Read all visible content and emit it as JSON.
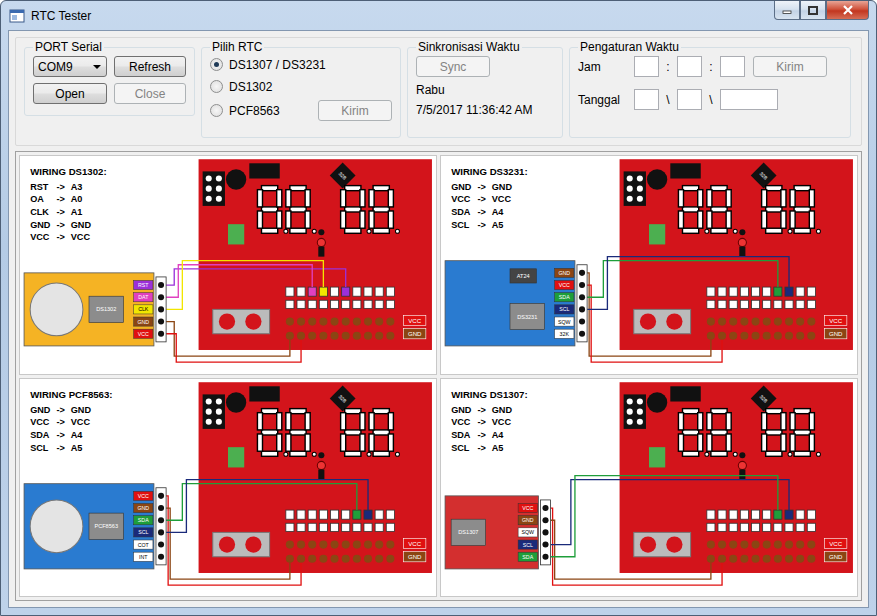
{
  "window": {
    "title": "RTC Tester"
  },
  "serial_port": {
    "title": "PORT Serial",
    "port": "COM9",
    "buttons": [
      {
        "label": "Refresh",
        "disabled": false
      },
      {
        "label": "Open",
        "disabled": false
      },
      {
        "label": "Close",
        "disabled": true
      }
    ]
  },
  "rtc_select": {
    "title": "Pilih RTC",
    "options": [
      {
        "label": "DS1307 / DS3231",
        "selected": true
      },
      {
        "label": "DS1302",
        "selected": false
      },
      {
        "label": "PCF8563",
        "selected": false
      }
    ],
    "send_button": {
      "label": "Kirim",
      "disabled": true
    }
  },
  "sync": {
    "title": "Sinkronisasi Waktu",
    "button": {
      "label": "Sync",
      "disabled": true
    },
    "day": "Rabu",
    "datetime": "7/5/2017 11:36:42 AM"
  },
  "time_setting": {
    "title": "Pengaturan Waktu",
    "time_label": "Jam",
    "time_separator": ":",
    "time_fields": [
      {
        "value": ""
      },
      {
        "value": ""
      },
      {
        "value": ""
      }
    ],
    "send_button": {
      "label": "Kirim",
      "disabled": true
    },
    "date_label": "Tanggal",
    "date_separator": "\\",
    "date_fields": [
      {
        "value": ""
      },
      {
        "value": ""
      },
      {
        "value": ""
      }
    ]
  },
  "diagrams": [
    {
      "title": "WIRING DS1302:",
      "arrow": "->",
      "wiring": [
        {
          "from": "RST",
          "to": "A3"
        },
        {
          "from": "OA",
          "to": "A0"
        },
        {
          "from": "CLK",
          "to": "A1"
        },
        {
          "from": "GND",
          "to": "GND"
        },
        {
          "from": "VCC",
          "to": "VCC"
        }
      ],
      "module": {
        "kind": "battery",
        "color": "#f5b324",
        "chips": [
          "DS1302"
        ],
        "pins": [
          {
            "label": "RST",
            "color": "#9b30d9",
            "to": "A3"
          },
          {
            "label": "DAT",
            "color": "#e040c0",
            "to": "A0"
          },
          {
            "label": "CLK",
            "color": "#f2e600",
            "to": "A1"
          },
          {
            "label": "GND",
            "color": "#8b4513",
            "to": "GND"
          },
          {
            "label": "VCC",
            "color": "#e01010",
            "to": "VCC"
          }
        ]
      },
      "board": {
        "chip": "328",
        "labels": [
          "VCC",
          "GND"
        ]
      }
    },
    {
      "title": "WIRING DS3231:",
      "arrow": "->",
      "wiring": [
        {
          "from": "GND",
          "to": "GND"
        },
        {
          "from": "VCC",
          "to": "VCC"
        },
        {
          "from": "SDA",
          "to": "A4"
        },
        {
          "from": "SCL",
          "to": "A5"
        }
      ],
      "module": {
        "kind": "battery-less",
        "color": "#2a7bd0",
        "chips": [
          "AT24",
          "DS3231"
        ],
        "pins": [
          {
            "label": "GND",
            "color": "#8b4513",
            "to": "GND"
          },
          {
            "label": "VCC",
            "color": "#e01010",
            "to": "VCC"
          },
          {
            "label": "SDA",
            "color": "#1e9e3a",
            "to": "A4"
          },
          {
            "label": "SCL",
            "color": "#1a2a7a",
            "to": "A5"
          },
          {
            "label": "SQW",
            "color": "#ffffff",
            "to": ""
          },
          {
            "label": "32K",
            "color": "#ffffff",
            "to": ""
          }
        ]
      },
      "board": {
        "chip": "328",
        "labels": [
          "VCC",
          "GND"
        ]
      }
    },
    {
      "title": "WIRING PCF8563:",
      "arrow": "->",
      "wiring": [
        {
          "from": "GND",
          "to": "GND"
        },
        {
          "from": "VCC",
          "to": "VCC"
        },
        {
          "from": "SDA",
          "to": "A4"
        },
        {
          "from": "SCL",
          "to": "A5"
        }
      ],
      "module": {
        "kind": "battery",
        "color": "#2a7bd0",
        "chips": [
          "PCF8563"
        ],
        "pins": [
          {
            "label": "VCC",
            "color": "#e01010",
            "to": "VCC"
          },
          {
            "label": "GND",
            "color": "#8b4513",
            "to": "GND"
          },
          {
            "label": "SDA",
            "color": "#1e9e3a",
            "to": "A4"
          },
          {
            "label": "SCL",
            "color": "#1a2a7a",
            "to": "A5"
          },
          {
            "label": "COT",
            "color": "#ffffff",
            "to": ""
          },
          {
            "label": "INT",
            "color": "#ffffff",
            "to": ""
          }
        ]
      },
      "board": {
        "chip": "328",
        "labels": [
          "VCC",
          "GND"
        ]
      }
    },
    {
      "title": "WIRING DS1307:",
      "arrow": "->",
      "wiring": [
        {
          "from": "GND",
          "to": "GND"
        },
        {
          "from": "VCC",
          "to": "VCC"
        },
        {
          "from": "SDA",
          "to": "A4"
        },
        {
          "from": "SCL",
          "to": "A5"
        }
      ],
      "module": {
        "kind": "plain",
        "color": "#d32f2f",
        "chips": [
          "DS1307"
        ],
        "pins": [
          {
            "label": "VCC",
            "color": "#e01010",
            "to": "VCC"
          },
          {
            "label": "GND",
            "color": "#8b4513",
            "to": "GND"
          },
          {
            "label": "SQW",
            "color": "#ffffff",
            "to": ""
          },
          {
            "label": "SCL",
            "color": "#1a2a7a",
            "to": "A5"
          },
          {
            "label": "SDA",
            "color": "#1e9e3a",
            "to": "A4"
          }
        ]
      },
      "board": {
        "chip": "328",
        "labels": [
          "VCC",
          "GND"
        ]
      }
    }
  ]
}
